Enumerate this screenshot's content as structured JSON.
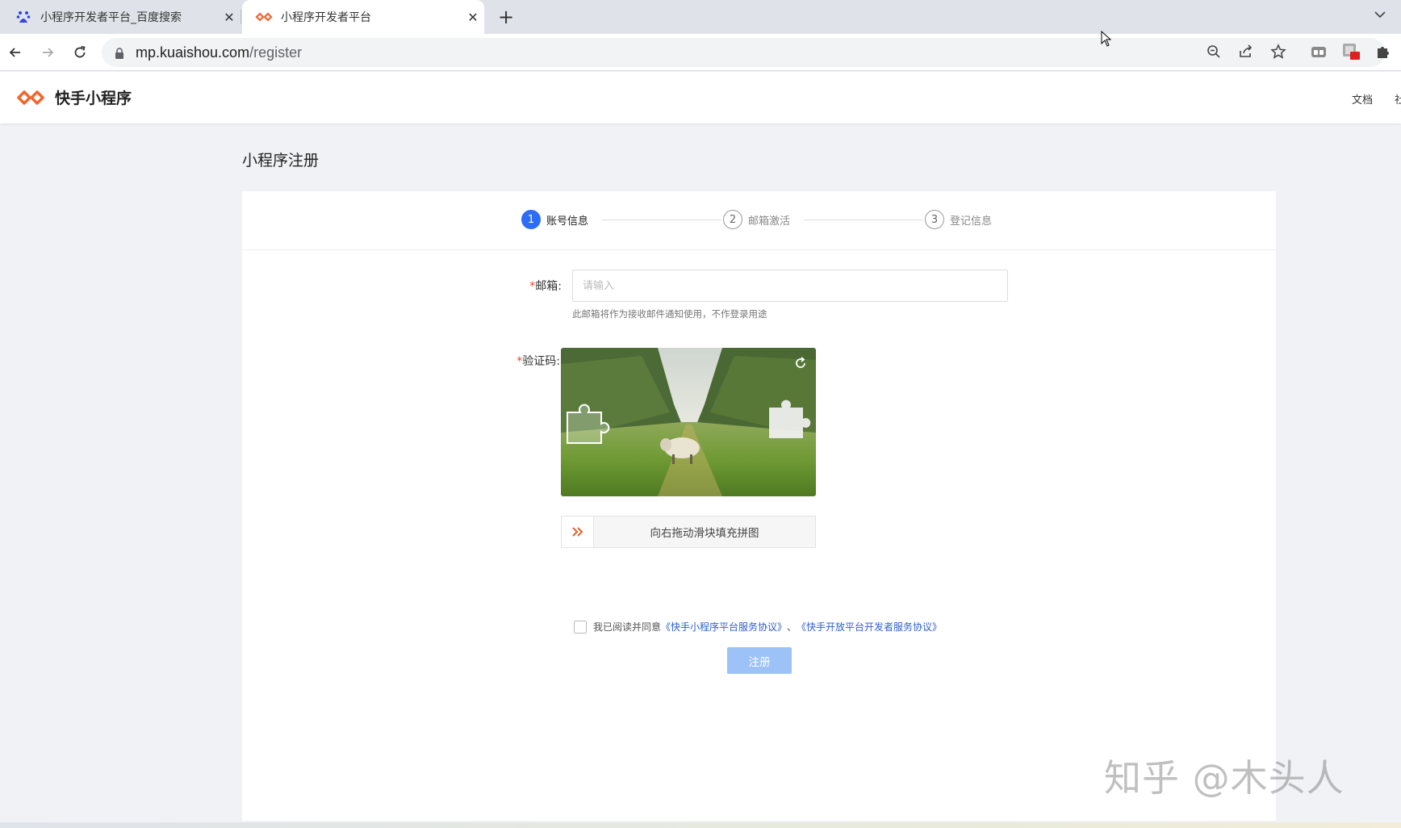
{
  "browser": {
    "tabs": [
      {
        "title": "小程序开发者平台_百度搜索",
        "icon": "baidu-paw-icon",
        "active": false
      },
      {
        "title": "小程序开发者平台",
        "icon": "kuaishou-logo-icon",
        "active": true
      }
    ],
    "url_host": "mp.kuaishou.com",
    "url_path": "/register"
  },
  "site": {
    "brand": "快手小程序",
    "nav_docs": "文档",
    "nav_more": "社"
  },
  "page": {
    "title": "小程序注册",
    "steps": [
      {
        "num": "1",
        "label": "账号信息",
        "active": true
      },
      {
        "num": "2",
        "label": "邮箱激活",
        "active": false
      },
      {
        "num": "3",
        "label": "登记信息",
        "active": false
      }
    ],
    "email": {
      "required_mark": "*",
      "label": "邮箱:",
      "placeholder": "请输入",
      "value": "",
      "hint": "此邮箱将作为接收邮件通知使用，不作登录用途"
    },
    "captcha": {
      "required_mark": "*",
      "label": "验证码:",
      "slider_text": "向右拖动滑块填充拼图"
    },
    "agreement": {
      "prefix": "我已阅读并同意",
      "link1": "《快手小程序平台服务协议》",
      "separator": "、",
      "link2": "《快手开放平台开发者服务协议》",
      "checked": false
    },
    "submit_label": "注册"
  },
  "watermark": "知乎 @木头人",
  "colors": {
    "accent": "#2d6df6",
    "brand": "#f0662e",
    "button_disabled": "#9dc2f7",
    "link": "#2d5fcf",
    "required": "#e8432f"
  }
}
